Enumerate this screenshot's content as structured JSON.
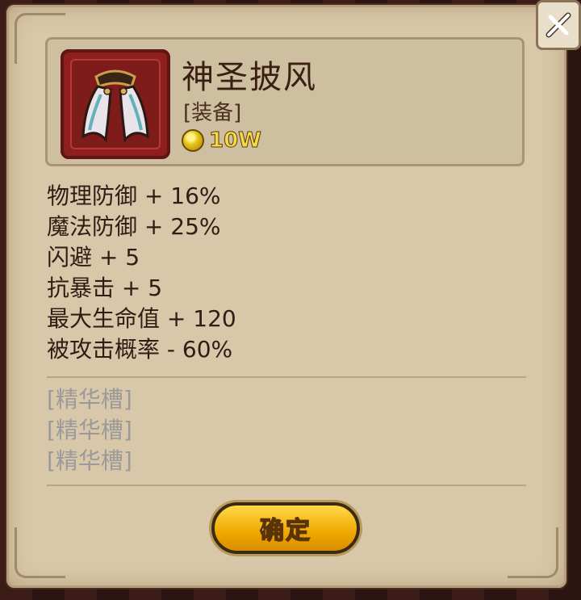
{
  "item": {
    "name": "神圣披风",
    "type": "[装备]",
    "price": "10W",
    "icon": "cloak-icon"
  },
  "stats": [
    "物理防御 + 16%",
    "魔法防御 + 25%",
    "闪避 + 5",
    "抗暴击 + 5",
    "最大生命值 + 120",
    "被攻击概率 - 60%"
  ],
  "essence_slots": [
    "[精华槽]",
    "[精华槽]",
    "[精华槽]"
  ],
  "buttons": {
    "confirm": "确定",
    "close_icon": "close-icon"
  },
  "colors": {
    "panel": "#d8c7a9",
    "item_frame": "#8f1f1f",
    "button": "#f0a800",
    "price": "#f5d94a"
  }
}
